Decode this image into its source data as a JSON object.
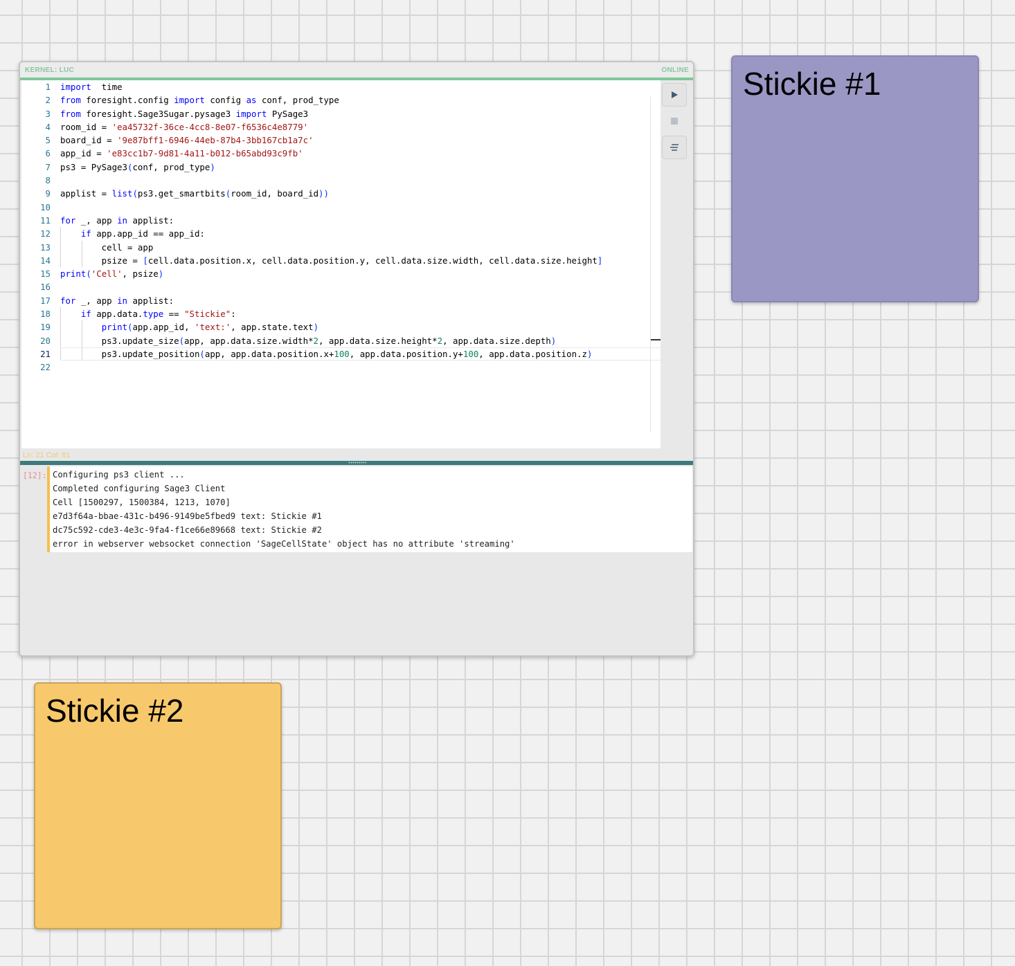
{
  "cell": {
    "kernel_label": "KERNEL: LUC",
    "status": "ONLINE",
    "cursor_info": "Ln: 21 Col: 81",
    "execution_count": "[12]:",
    "code_lines": [
      {
        "num": "1",
        "tokens": [
          [
            "kw",
            "import"
          ],
          [
            "",
            "  time"
          ]
        ]
      },
      {
        "num": "2",
        "tokens": [
          [
            "kw",
            "from"
          ],
          [
            "",
            " foresight.config "
          ],
          [
            "kw",
            "import"
          ],
          [
            "",
            " config "
          ],
          [
            "kw",
            "as"
          ],
          [
            "",
            " conf, prod_type"
          ]
        ]
      },
      {
        "num": "3",
        "tokens": [
          [
            "kw",
            "from"
          ],
          [
            "",
            " foresight.Sage3Sugar.pysage3 "
          ],
          [
            "kw",
            "import"
          ],
          [
            "",
            " PySage3"
          ]
        ]
      },
      {
        "num": "4",
        "tokens": [
          [
            "",
            "room_id = "
          ],
          [
            "str",
            "'ea45732f-36ce-4cc8-8e07-f6536c4e8779'"
          ]
        ]
      },
      {
        "num": "5",
        "tokens": [
          [
            "",
            "board_id = "
          ],
          [
            "str",
            "'9e87bff1-6946-44eb-87b4-3bb167cb1a7c'"
          ]
        ]
      },
      {
        "num": "6",
        "tokens": [
          [
            "",
            "app_id = "
          ],
          [
            "str",
            "'e83cc1b7-9d81-4a11-b012-b65abd93c9fb'"
          ]
        ]
      },
      {
        "num": "7",
        "tokens": [
          [
            "",
            "ps3 = PySage3"
          ],
          [
            "br",
            "("
          ],
          [
            "",
            "conf, prod_type"
          ],
          [
            "br",
            ")"
          ]
        ]
      },
      {
        "num": "8",
        "tokens": []
      },
      {
        "num": "9",
        "tokens": [
          [
            "",
            "applist = "
          ],
          [
            "kw",
            "list"
          ],
          [
            "br",
            "("
          ],
          [
            "",
            "ps3.get_smartbits"
          ],
          [
            "br",
            "("
          ],
          [
            "",
            "room_id, board_id"
          ],
          [
            "br",
            "))"
          ]
        ]
      },
      {
        "num": "10",
        "tokens": []
      },
      {
        "num": "11",
        "tokens": [
          [
            "kw",
            "for"
          ],
          [
            "",
            " _, app "
          ],
          [
            "kw",
            "in"
          ],
          [
            "",
            " applist:"
          ]
        ]
      },
      {
        "num": "12",
        "tokens": [
          [
            "",
            "    "
          ],
          [
            "kw",
            "if"
          ],
          [
            "",
            " app.app_id == app_id:"
          ]
        ]
      },
      {
        "num": "13",
        "tokens": [
          [
            "",
            "        cell = app"
          ]
        ]
      },
      {
        "num": "14",
        "tokens": [
          [
            "",
            "        psize = "
          ],
          [
            "br",
            "["
          ],
          [
            "",
            "cell.data.position.x, cell.data.position.y, cell.data.size.width, cell.data.size.height"
          ],
          [
            "br",
            "]"
          ]
        ]
      },
      {
        "num": "15",
        "tokens": [
          [
            "kw",
            "print"
          ],
          [
            "br",
            "("
          ],
          [
            "str",
            "'Cell'"
          ],
          [
            "",
            ", psize"
          ],
          [
            "br",
            ")"
          ]
        ]
      },
      {
        "num": "16",
        "tokens": []
      },
      {
        "num": "17",
        "tokens": [
          [
            "kw",
            "for"
          ],
          [
            "",
            " _, app "
          ],
          [
            "kw",
            "in"
          ],
          [
            "",
            " applist:"
          ]
        ]
      },
      {
        "num": "18",
        "tokens": [
          [
            "",
            "    "
          ],
          [
            "kw",
            "if"
          ],
          [
            "",
            " app.data."
          ],
          [
            "kw",
            "type"
          ],
          [
            "",
            " == "
          ],
          [
            "str",
            "\"Stickie\""
          ],
          [
            "",
            ":"
          ]
        ]
      },
      {
        "num": "19",
        "tokens": [
          [
            "",
            "        "
          ],
          [
            "kw",
            "print"
          ],
          [
            "br",
            "("
          ],
          [
            "",
            "app.app_id, "
          ],
          [
            "str",
            "'text:'"
          ],
          [
            "",
            ", app.state.text"
          ],
          [
            "br",
            ")"
          ]
        ]
      },
      {
        "num": "20",
        "tokens": [
          [
            "",
            "        ps3.update_size"
          ],
          [
            "br",
            "("
          ],
          [
            "",
            "app, app.data.size.width*"
          ],
          [
            "num",
            "2"
          ],
          [
            "",
            ", app.data.size.height*"
          ],
          [
            "num",
            "2"
          ],
          [
            "",
            ", app.data.size.depth"
          ],
          [
            "br",
            ")"
          ]
        ]
      },
      {
        "num": "21",
        "tokens": [
          [
            "",
            "        ps3.update_position"
          ],
          [
            "br",
            "("
          ],
          [
            "",
            "app, app.data.position.x+"
          ],
          [
            "num",
            "100"
          ],
          [
            "",
            ", app.data.position.y+"
          ],
          [
            "num",
            "100"
          ],
          [
            "",
            ", app.data.position.z"
          ],
          [
            "br",
            ")"
          ]
        ]
      },
      {
        "num": "22",
        "tokens": []
      }
    ],
    "active_line": "21",
    "output_lines": [
      "Configuring ps3 client ...",
      "Completed configuring Sage3 Client",
      "Cell [1500297, 1500384, 1213, 1070]",
      "e7d3f64a-bbae-431c-b496-9149be5fbed9 text: Stickie #1",
      "dc75c592-cde3-4e3c-9fa4-f1ce66e89668 text: Stickie #2",
      "error in webserver websocket connection 'SageCellState' object has no attribute 'streaming'"
    ],
    "buttons": {
      "run_icon": "play-icon",
      "stop_icon": "stop-icon",
      "format_icon": "format-lines-icon"
    }
  },
  "stickie1": {
    "text": "Stickie #1",
    "color": "#9b97c4"
  },
  "stickie2": {
    "text": "Stickie #2",
    "color": "#f7c96c"
  }
}
